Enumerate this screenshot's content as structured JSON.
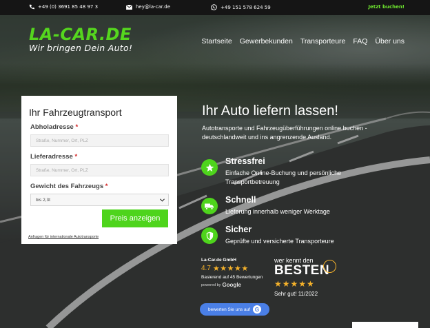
{
  "topbar": {
    "phone": "+49 (0) 3691 85 48 97 3",
    "email": "hey@la-car.de",
    "whatsapp": "+49 151 578 624 59",
    "cta": "Jetzt buchen!"
  },
  "logo": {
    "name": "LA-CAR.DE",
    "tagline": "Wir bringen Dein Auto!"
  },
  "nav": [
    "Startseite",
    "Gewerbekunden",
    "Transporteure",
    "FAQ",
    "Über uns"
  ],
  "form": {
    "title": "Ihr Fahrzeugtransport",
    "pickup_label": "Abholadresse",
    "pickup_placeholder": "Straße, Nummer, Ort, PLZ",
    "delivery_label": "Lieferadresse",
    "delivery_placeholder": "Straße, Nummer, Ort, PLZ",
    "weight_label": "Gewicht des Fahrzeugs",
    "weight_value": "bis 2,3t",
    "required_mark": "*",
    "submit": "Preis anzeigen",
    "intl_link": "Anfragen für internationale Autotransporte"
  },
  "hero": {
    "headline": "Ihr Auto liefern lassen!",
    "subline": "Autotransporte und Fahrzeugüberführungen online buchen - deutschlandweit und ins angrenzende Ausland."
  },
  "features": [
    {
      "icon": "star-icon",
      "title": "Stressfrei",
      "desc": "Einfache Online-Buchung und persönliche Transportbetreuung"
    },
    {
      "icon": "truck-icon",
      "title": "Schnell",
      "desc": "Lieferung innerhalb weniger Werktage"
    },
    {
      "icon": "shield-icon",
      "title": "Sicher",
      "desc": "Geprüfte und versicherte Transporteure"
    }
  ],
  "google_badge": {
    "company": "La-Car.de GmbH",
    "rating": "4.7",
    "stars": "★★★★★",
    "basis": "Basierend auf 45 Bewertungen",
    "powered_by": "powered by",
    "google": "Google",
    "review_button": "bewerten Sie uns auf",
    "review_g": "G"
  },
  "wkdb_badge": {
    "top": "wer kennt den",
    "besten": "BESTEN",
    "stars": "★★★★★",
    "good": "Sehr gut! 11/2022"
  },
  "colors": {
    "accent": "#4ed41c",
    "star": "#f5b22b",
    "topbar": "#151515"
  }
}
